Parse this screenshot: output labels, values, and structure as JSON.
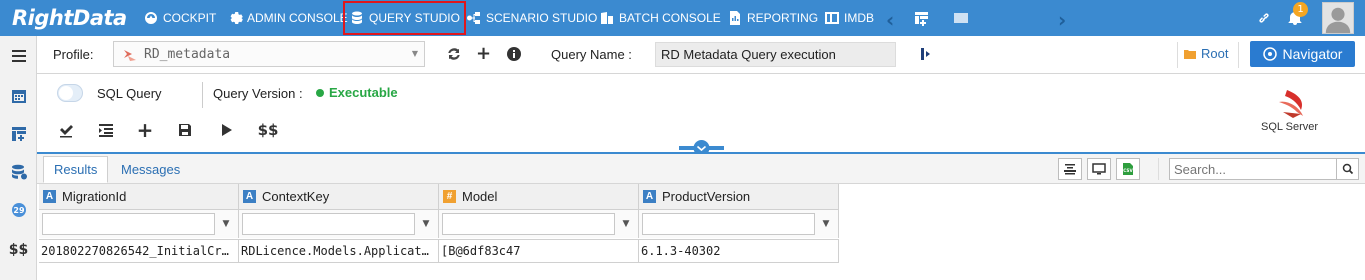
{
  "brand": {
    "logo_text": "RightData"
  },
  "nav": {
    "items": [
      {
        "label": "COCKPIT",
        "icon": "gauge-icon"
      },
      {
        "label": "ADMIN CONSOLE",
        "icon": "gear-icon"
      },
      {
        "label": "QUERY STUDIO",
        "icon": "database-icon",
        "active": true
      },
      {
        "label": "SCENARIO STUDIO",
        "icon": "flow-icon"
      },
      {
        "label": "BATCH CONSOLE",
        "icon": "building-icon"
      },
      {
        "label": "REPORTING",
        "icon": "report-icon"
      },
      {
        "label": "IMDB",
        "icon": "columns-icon"
      }
    ],
    "notification_count": "1"
  },
  "profile_bar": {
    "profile_label": "Profile:",
    "profile_value": "RD_metadata",
    "query_name_label": "Query Name :",
    "query_name_value": "RD Metadata Query execution",
    "root_label": "Root",
    "navigator_label": "Navigator"
  },
  "query_header": {
    "toggle_label": "SQL Query",
    "version_label": "Query Version :",
    "version_status": "Executable",
    "status_color": "#28a745",
    "dollar_label": "$$",
    "sql_server_label": "SQL Server"
  },
  "results": {
    "tabs": [
      {
        "label": "Results",
        "active": true
      },
      {
        "label": "Messages",
        "active": false
      }
    ],
    "search_placeholder": "Search...",
    "csv_label": "CSV",
    "columns": [
      {
        "type": "A",
        "name": "MigrationId"
      },
      {
        "type": "A",
        "name": "ContextKey"
      },
      {
        "type": "#",
        "name": "Model"
      },
      {
        "type": "A",
        "name": "ProductVersion"
      }
    ],
    "rows": [
      [
        "201802270826542_InitialCr...",
        "RDLicence.Models.Applicati...",
        "[B@6df83c47",
        "6.1.3-40302"
      ]
    ]
  },
  "sidebar": {
    "dollar_label": "$$"
  },
  "colors": {
    "accent": "#3b8ad0",
    "highlight": "#e0171d",
    "link": "#2b6fb3"
  }
}
